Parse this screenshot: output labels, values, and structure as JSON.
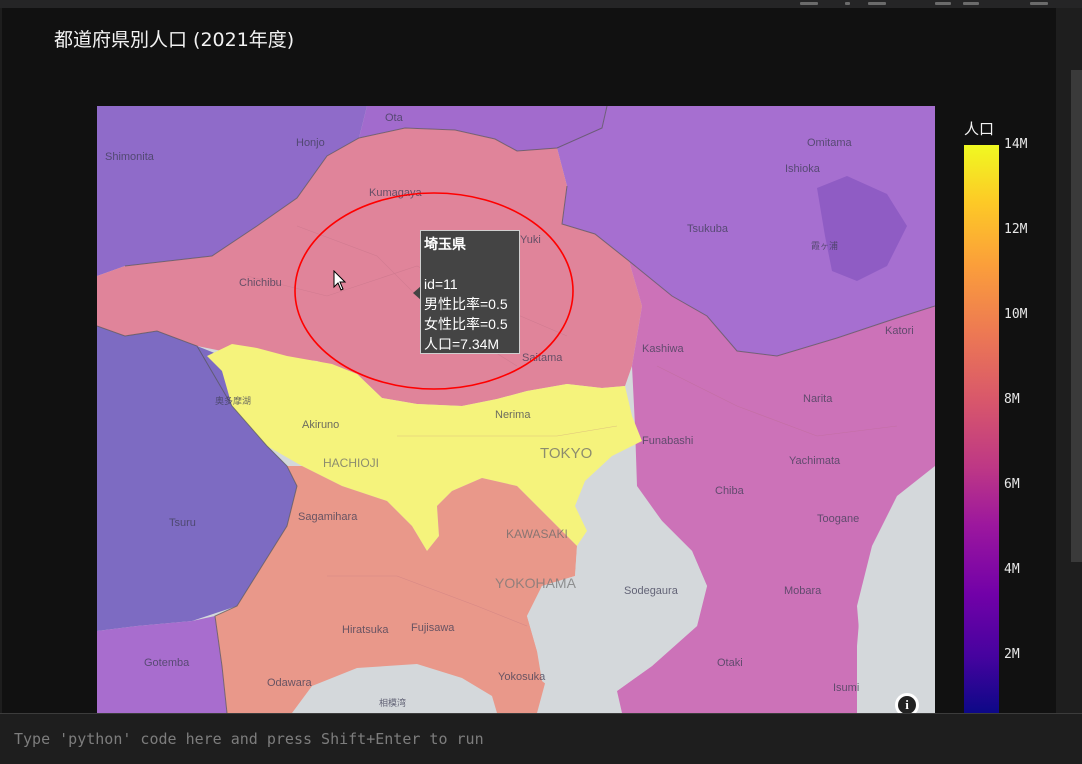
{
  "chart": {
    "title": "都道府県別人口 (2021年度)"
  },
  "colorbar": {
    "title": "人口",
    "ticks": [
      "14M",
      "12M",
      "10M",
      "8M",
      "6M",
      "4M",
      "2M"
    ]
  },
  "chart_data": {
    "type": "choropleth",
    "title": "都道府県別人口 (2021年度)",
    "color_axis": {
      "title": "人口",
      "colorscale": "plasma",
      "tick_values": [
        2,
        4,
        6,
        8,
        10,
        12,
        14
      ],
      "tick_unit": "M"
    },
    "hovered_region": {
      "name": "埼玉県",
      "id": 11,
      "male_ratio": 0.5,
      "female_ratio": 0.5,
      "population": "7.34M"
    }
  },
  "map_labels": {
    "ota": "Ota",
    "honjo": "Honjo",
    "shimonita": "Shimonita",
    "kumagaya": "Kumagaya",
    "chichibu": "Chichibu",
    "tsukuba": "Tsukuba",
    "omitama": "Omitama",
    "ishioka": "Ishioka",
    "kasumigaura": "霞ヶ浦",
    "katori": "Katori",
    "kashiwa": "Kashiwa",
    "saitama": "Saitama",
    "narita": "Narita",
    "akiruno": "Akiruno",
    "nerima": "Nerima",
    "tokyo": "TOKYO",
    "hachioji": "HACHIOJI",
    "funabashi": "Funabashi",
    "yachimata": "Yachimata",
    "chiba": "Chiba",
    "tsuru": "Tsuru",
    "sagamihara": "Sagamihara",
    "kawasaki": "KAWASAKI",
    "toogane": "Toogane",
    "yokohama": "YOKOHAMA",
    "sodegaura": "Sodegaura",
    "mobara": "Mobara",
    "hiratsuka": "Hiratsuka",
    "fujisawa": "Fujisawa",
    "gotemba": "Gotemba",
    "odawara": "Odawara",
    "yokosuka": "Yokosuka",
    "otaki": "Otaki",
    "isumi": "Isumi",
    "sagamiwan": "相模湾",
    "okutama": "奥多摩湖",
    "yuki": "Yuki"
  },
  "tooltip": {
    "name": "埼玉県",
    "id": "id=11",
    "male": "男性比率=0.5",
    "female": "女性比率=0.5",
    "pop": "人口=7.34M"
  },
  "input": {
    "placeholder": "Type 'python' code here and press Shift+Enter to run"
  },
  "colors": {
    "saitama": "#e0849a",
    "tokyo": "#f5f37c",
    "kanagawa": "#e9988a",
    "chiba": "#cc72b8",
    "ibaraki": "#a66fd0",
    "yamanashi": "#7d6bc2",
    "gunma": "#8f6bc9",
    "sea": "#d4d8db",
    "highlight": "#ff0000"
  }
}
